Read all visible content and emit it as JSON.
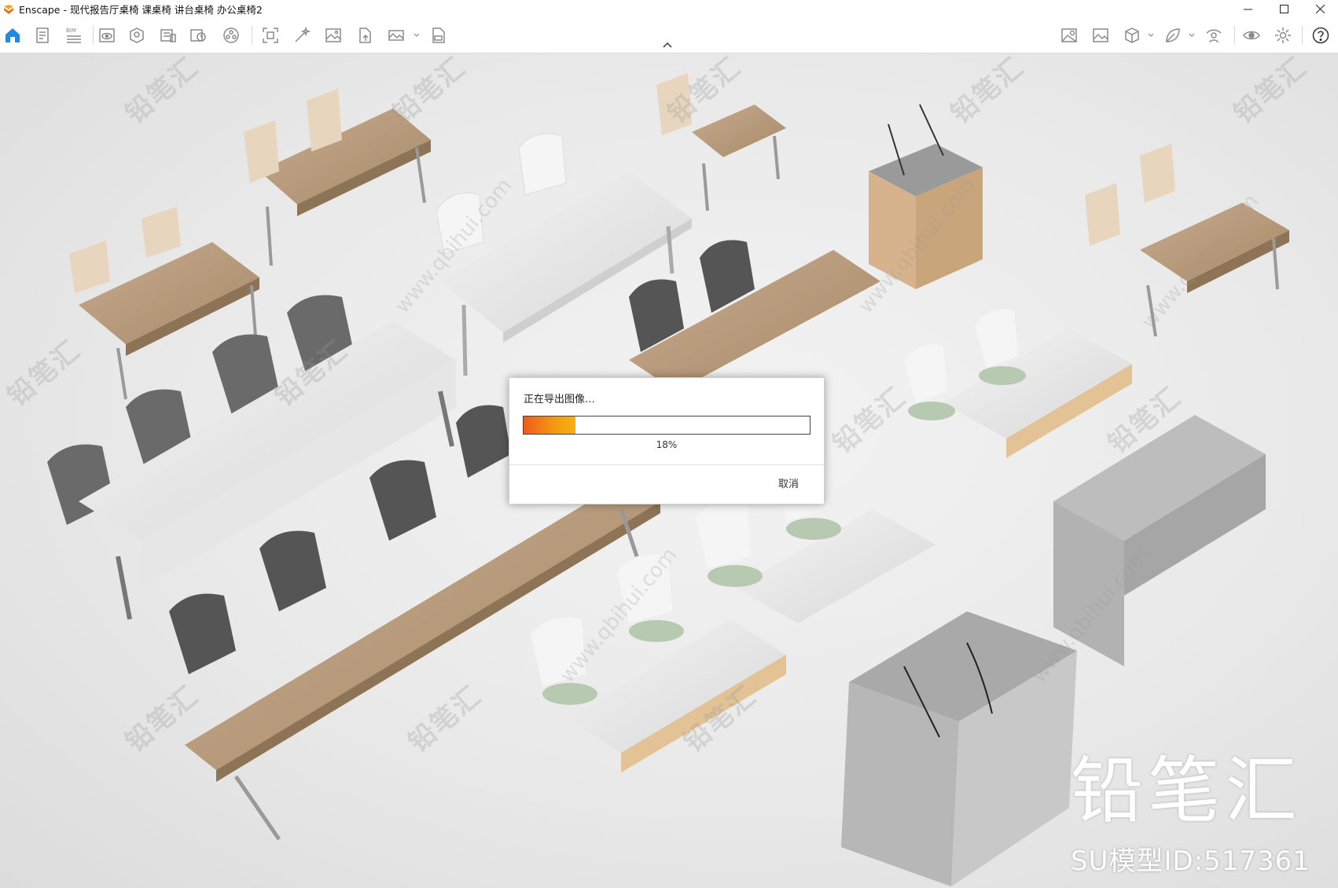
{
  "window": {
    "title": "Enscape - 现代报告厅桌椅 课桌椅 讲台桌椅 办公桌椅2",
    "controls": [
      "—",
      "☐",
      "✕"
    ]
  },
  "toolbar": {
    "left_icons": [
      "home-icon",
      "document-icon",
      "bim-icon",
      "preview-icon",
      "asset-icon",
      "render-icon",
      "video-icon",
      "panorama-icon",
      "screenshot-icon",
      "magic-wand-icon",
      "image-icon",
      "file-export-icon",
      "panorama-360-icon",
      "exe-export-icon"
    ],
    "bim_label": "BIM",
    "right_icons": [
      "map-icon",
      "gallery-icon",
      "cube-icon",
      "leaf-icon",
      "person-icon",
      "eye-icon",
      "settings-icon",
      "help-icon"
    ],
    "accent_color": "#1e88e5"
  },
  "viewport": {
    "watermark_text": "铅笔汇",
    "watermark_url": "www.qbihui.com",
    "brand_text": "铅笔汇",
    "model_id_text": "SU模型ID:517361"
  },
  "dialog": {
    "message": "正在导出图像…",
    "progress_percent": 18,
    "progress_text": "18%",
    "cancel_label": "取消"
  }
}
